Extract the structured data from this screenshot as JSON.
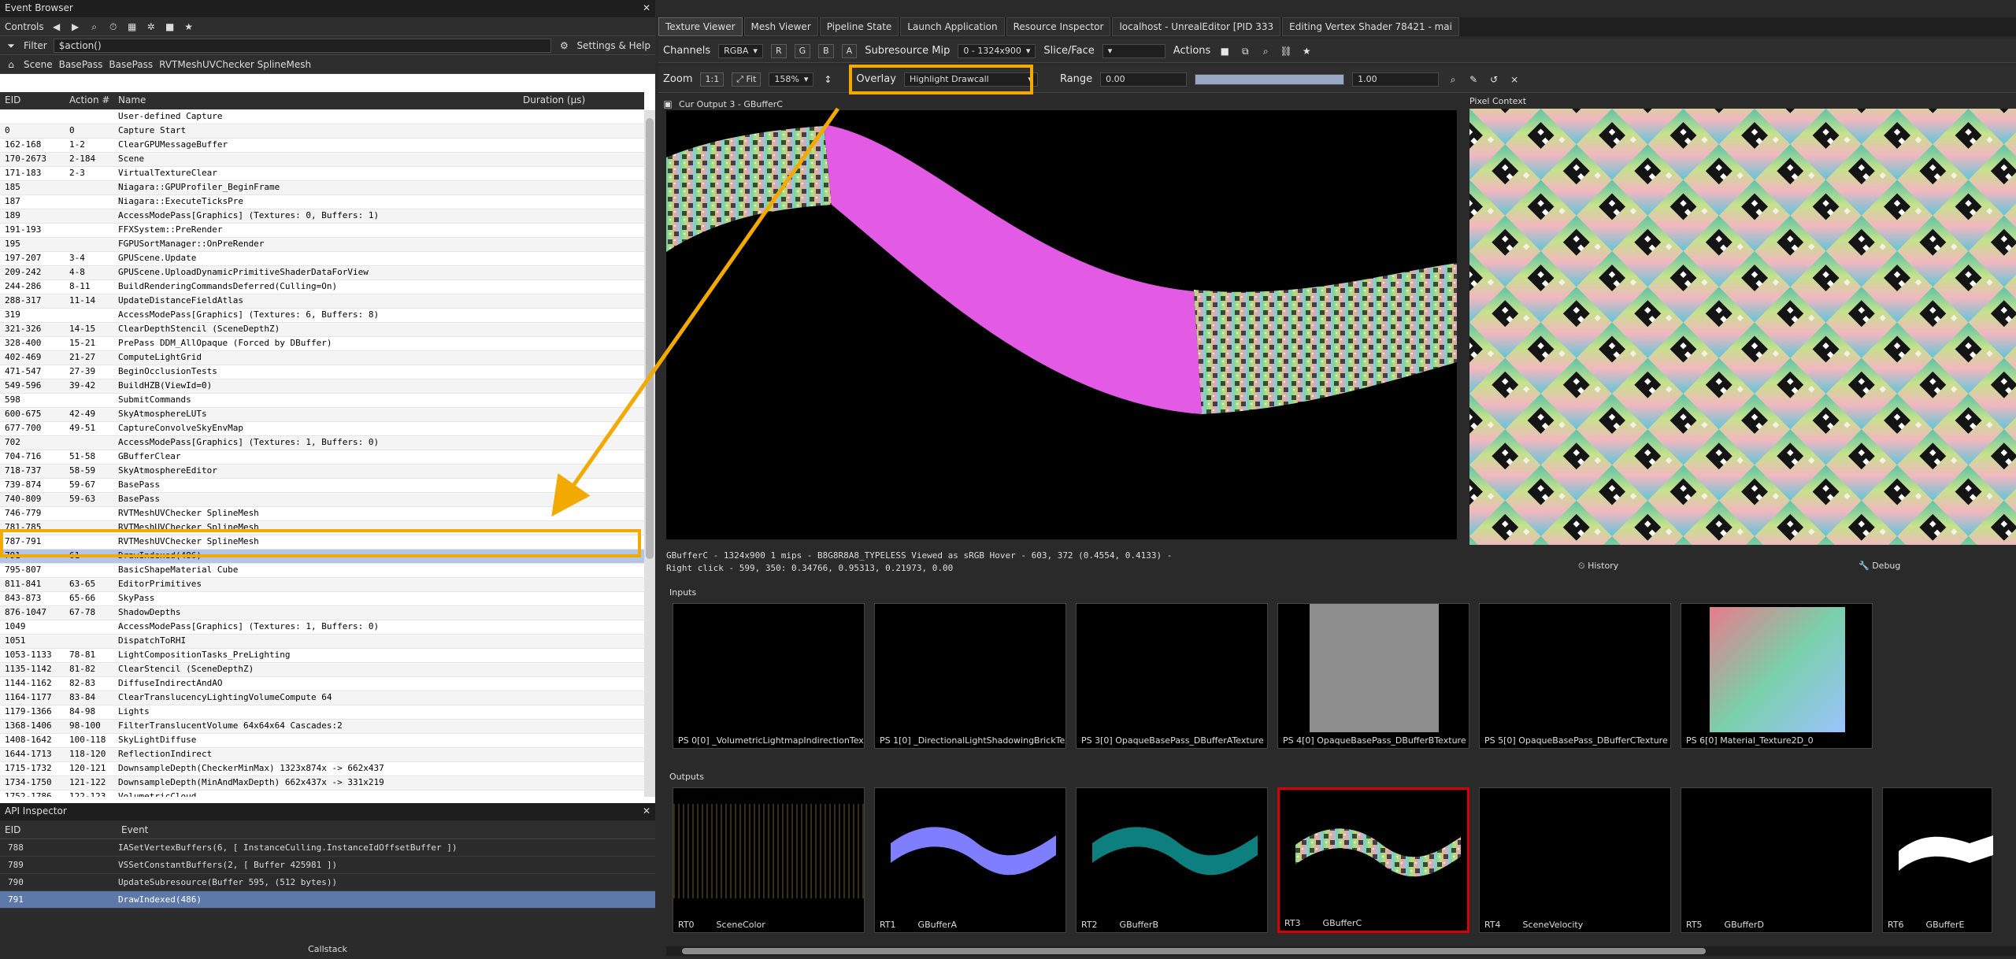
{
  "left": {
    "title": "Event Browser",
    "controls_label": "Controls",
    "filter_label": "Filter",
    "filter_value": "$action()",
    "settings_help": "Settings & Help",
    "breadcrumb": [
      "Scene",
      "BasePass",
      "BasePass",
      "RVTMeshUVChecker SplineMesh"
    ],
    "columns": {
      "eid": "EID",
      "action": "Action #",
      "name": "Name",
      "duration": "Duration (µs)"
    },
    "rows": [
      {
        "eid": "",
        "action": "",
        "name": "User-defined Capture"
      },
      {
        "eid": "0",
        "action": "0",
        "name": "Capture Start"
      },
      {
        "eid": "162-168",
        "action": "1-2",
        "name": "ClearGPUMessageBuffer"
      },
      {
        "eid": "170-2673",
        "action": "2-184",
        "name": "Scene"
      },
      {
        "eid": "171-183",
        "action": "2-3",
        "name": "VirtualTextureClear"
      },
      {
        "eid": "185",
        "action": "",
        "name": "Niagara::GPUProfiler_BeginFrame"
      },
      {
        "eid": "187",
        "action": "",
        "name": "Niagara::ExecuteTicksPre"
      },
      {
        "eid": "189",
        "action": "",
        "name": "AccessModePass[Graphics] (Textures: 0, Buffers: 1)"
      },
      {
        "eid": "191-193",
        "action": "",
        "name": "FFXSystem::PreRender"
      },
      {
        "eid": "195",
        "action": "",
        "name": "FGPUSortManager::OnPreRender"
      },
      {
        "eid": "197-207",
        "action": "3-4",
        "name": "GPUScene.Update"
      },
      {
        "eid": "209-242",
        "action": "4-8",
        "name": "GPUScene.UploadDynamicPrimitiveShaderDataForView"
      },
      {
        "eid": "244-286",
        "action": "8-11",
        "name": "BuildRenderingCommandsDeferred(Culling=On)"
      },
      {
        "eid": "288-317",
        "action": "11-14",
        "name": "UpdateDistanceFieldAtlas"
      },
      {
        "eid": "319",
        "action": "",
        "name": "AccessModePass[Graphics] (Textures: 6, Buffers: 8)"
      },
      {
        "eid": "321-326",
        "action": "14-15",
        "name": "ClearDepthStencil (SceneDepthZ)"
      },
      {
        "eid": "328-400",
        "action": "15-21",
        "name": "PrePass DDM_AllOpaque (Forced by DBuffer)"
      },
      {
        "eid": "402-469",
        "action": "21-27",
        "name": "ComputeLightGrid"
      },
      {
        "eid": "471-547",
        "action": "27-39",
        "name": "BeginOcclusionTests"
      },
      {
        "eid": "549-596",
        "action": "39-42",
        "name": "BuildHZB(ViewId=0)"
      },
      {
        "eid": "598",
        "action": "",
        "name": "SubmitCommands"
      },
      {
        "eid": "600-675",
        "action": "42-49",
        "name": "SkyAtmosphereLUTs"
      },
      {
        "eid": "677-700",
        "action": "49-51",
        "name": "CaptureConvolveSkyEnvMap"
      },
      {
        "eid": "702",
        "action": "",
        "name": "AccessModePass[Graphics] (Textures: 1, Buffers: 0)"
      },
      {
        "eid": "704-716",
        "action": "51-58",
        "name": "GBufferClear"
      },
      {
        "eid": "718-737",
        "action": "58-59",
        "name": "SkyAtmosphereEditor"
      },
      {
        "eid": "739-874",
        "action": "59-67",
        "name": "BasePass"
      },
      {
        "eid": "740-809",
        "action": "59-63",
        "name": "BasePass"
      },
      {
        "eid": "746-779",
        "action": "",
        "name": "RVTMeshUVChecker SplineMesh"
      },
      {
        "eid": "781-785",
        "action": "",
        "name": "RVTMeshUVChecker SplineMesh"
      },
      {
        "eid": "787-791",
        "action": "",
        "name": "RVTMeshUVChecker SplineMesh"
      },
      {
        "eid": "791",
        "action": "61",
        "name": "DrawIndexed(486)"
      },
      {
        "eid": "795-807",
        "action": "",
        "name": "BasicShapeMaterial Cube"
      },
      {
        "eid": "811-841",
        "action": "63-65",
        "name": "EditorPrimitives"
      },
      {
        "eid": "843-873",
        "action": "65-66",
        "name": "SkyPass"
      },
      {
        "eid": "876-1047",
        "action": "67-78",
        "name": "ShadowDepths"
      },
      {
        "eid": "1049",
        "action": "",
        "name": "AccessModePass[Graphics] (Textures: 1, Buffers: 0)"
      },
      {
        "eid": "1051",
        "action": "",
        "name": "DispatchToRHI"
      },
      {
        "eid": "1053-1133",
        "action": "78-81",
        "name": "LightCompositionTasks_PreLighting"
      },
      {
        "eid": "1135-1142",
        "action": "81-82",
        "name": "ClearStencil (SceneDepthZ)"
      },
      {
        "eid": "1144-1162",
        "action": "82-83",
        "name": "DiffuseIndirectAndAO"
      },
      {
        "eid": "1164-1177",
        "action": "83-84",
        "name": "ClearTranslucencyLightingVolumeCompute 64"
      },
      {
        "eid": "1179-1366",
        "action": "84-98",
        "name": "Lights"
      },
      {
        "eid": "1368-1406",
        "action": "98-100",
        "name": "FilterTranslucentVolume 64x64x64 Cascades:2"
      },
      {
        "eid": "1408-1642",
        "action": "100-118",
        "name": "SkyLightDiffuse"
      },
      {
        "eid": "1644-1713",
        "action": "118-120",
        "name": "ReflectionIndirect"
      },
      {
        "eid": "1715-1732",
        "action": "120-121",
        "name": "DownsampleDepth(CheckerMinMax) 1323x874x -> 662x437"
      },
      {
        "eid": "1734-1750",
        "action": "121-122",
        "name": "DownsampleDepth(MinAndMaxDepth) 662x437x -> 331x219"
      },
      {
        "eid": "1752-1786",
        "action": "122-123",
        "name": "VolumetricCloud"
      }
    ]
  },
  "api": {
    "title": "API Inspector",
    "columns": {
      "eid": "EID",
      "event": "Event"
    },
    "rows": [
      {
        "eid": "788",
        "event": "IASetVertexBuffers(6, [ InstanceCulling.InstanceIdOffsetBuffer ])"
      },
      {
        "eid": "789",
        "event": "VSSetConstantBuffers(2, [ Buffer 425981 ])"
      },
      {
        "eid": "790",
        "event": "UpdateSubresource(Buffer 595, (512 bytes))"
      },
      {
        "eid": "791",
        "event": "DrawIndexed(486)"
      }
    ],
    "footer": "Callstack"
  },
  "tabs": [
    "Texture Viewer",
    "Mesh Viewer",
    "Pipeline State",
    "Launch Application",
    "Resource Inspector",
    "localhost - UnrealEditor [PID 333",
    "Editing Vertex Shader 78421 - mai"
  ],
  "toolbar": {
    "channels_label": "Channels",
    "channels_value": "RGBA",
    "rgb_buttons": [
      "R",
      "G",
      "B",
      "A"
    ],
    "subresource_label": "Subresource Mip",
    "subresource_value": "0 - 1324x900",
    "slice_label": "Slice/Face",
    "actions_label": "Actions",
    "zoom_label": "Zoom",
    "zoom_1to1": "1:1",
    "fit_label": "Fit",
    "zoom_value": "158%",
    "overlay_label": "Overlay",
    "overlay_value": "Highlight Drawcall",
    "range_label": "Range",
    "range_min": "0.00",
    "range_max": "1.00"
  },
  "viewer": {
    "tab_label": "Cur Output 3 - GBufferC",
    "pixel_context_label": "Pixel Context",
    "history": "History",
    "debug": "Debug",
    "status_line1": "GBufferC - 1324x900 1 mips - B8G8R8A8_TYPELESS Viewed as sRGB       Hover -   603,  372 (0.4554, 0.4133)  -",
    "status_line2": "Right click -   599,  350: 0.34766, 0.95313, 0.21973, 0.00"
  },
  "inputs": {
    "label": "Inputs",
    "items": [
      "PS 0[0] _VolumetricLightmapIndirectionTex",
      "PS 1[0] _DirectionalLightShadowingBrickTex",
      "PS 3[0] OpaqueBasePass_DBufferATexture",
      "PS 4[0] OpaqueBasePass_DBufferBTexture",
      "PS 5[0] OpaqueBasePass_DBufferCTexture",
      "PS 6[0]                    Material_Texture2D_0"
    ]
  },
  "outputs": {
    "label": "Outputs",
    "items": [
      {
        "rt": "RT0",
        "name": "SceneColor"
      },
      {
        "rt": "RT1",
        "name": "GBufferA"
      },
      {
        "rt": "RT2",
        "name": "GBufferB"
      },
      {
        "rt": "RT3",
        "name": "GBufferC"
      },
      {
        "rt": "RT4",
        "name": "SceneVelocity"
      },
      {
        "rt": "RT5",
        "name": "GBufferD"
      },
      {
        "rt": "RT6",
        "name": "GBufferE"
      }
    ]
  },
  "colors": {
    "highlight": "#f2a900",
    "selected_output": "#d60000",
    "magenta": "#e35be4"
  }
}
